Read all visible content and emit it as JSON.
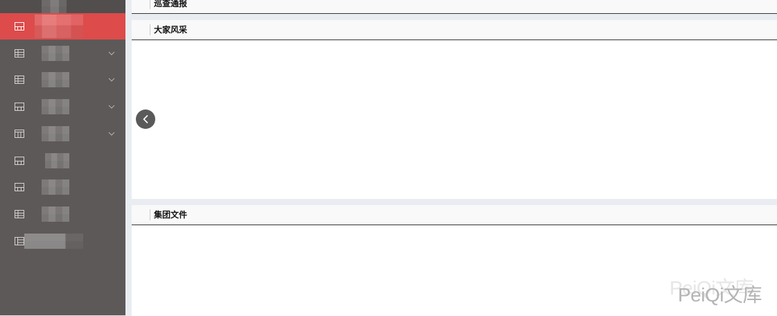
{
  "sidebar": {
    "items": [
      {
        "icon": "card-icon",
        "active": true,
        "submenu": false
      },
      {
        "icon": "table-icon",
        "active": false,
        "submenu": true
      },
      {
        "icon": "table-icon",
        "active": false,
        "submenu": true
      },
      {
        "icon": "card-icon",
        "active": false,
        "submenu": true
      },
      {
        "icon": "calendar-icon",
        "active": false,
        "submenu": true
      },
      {
        "icon": "card-icon",
        "active": false,
        "submenu": false
      },
      {
        "icon": "card-icon",
        "active": false,
        "submenu": false
      },
      {
        "icon": "table-icon",
        "active": false,
        "submenu": false
      },
      {
        "icon": "columns-icon",
        "active": false,
        "submenu": false
      }
    ],
    "submenu_icon": "chevron-down-icon"
  },
  "main": {
    "panels": [
      {
        "title": "巡查通报"
      },
      {
        "title": "大家风采",
        "carousel_prev_icon": "chevron-left-icon"
      },
      {
        "title": "集团文件"
      }
    ]
  },
  "watermark": "PeiQi文库",
  "colors": {
    "sidebar_bg": "#5e5959",
    "sidebar_top": "#524e4e",
    "sidebar_active": "#dd4b4b",
    "page_bg": "#e9edf2",
    "panel_header_bg": "#f9f9f9",
    "panel_body_bg": "#ffffff",
    "header_rule": "#333333",
    "carousel_button": "#5a5a5a",
    "watermark": "#b4b4b4"
  }
}
